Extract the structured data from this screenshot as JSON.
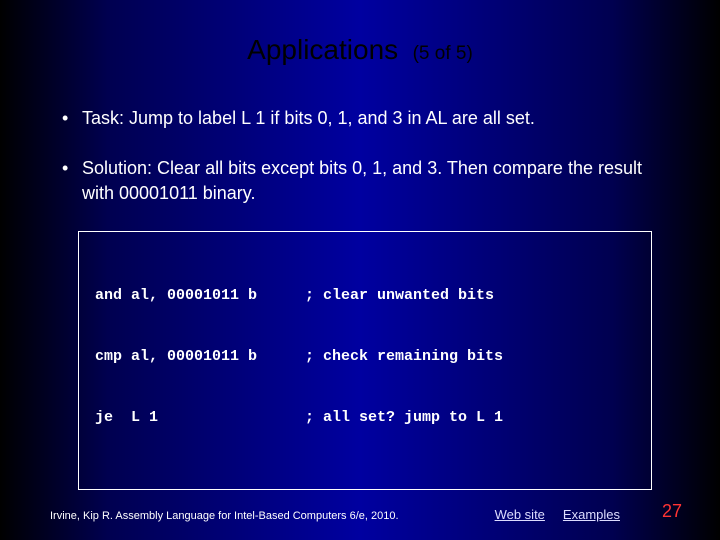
{
  "title": {
    "main": "Applications",
    "sub": "(5 of 5)"
  },
  "bullets": [
    "Task: Jump to label L 1 if bits 0, 1, and 3 in AL are all set.",
    "Solution: Clear all bits except bits 0, 1, and 3. Then compare the result with 00001011 binary."
  ],
  "code": {
    "lines": [
      {
        "left": "and al, 00001011 b",
        "right": "; clear unwanted bits"
      },
      {
        "left": "cmp al, 00001011 b",
        "right": "; check remaining bits"
      },
      {
        "left": "je  L 1",
        "right": "; all set? jump to L 1"
      }
    ]
  },
  "footer": {
    "citation": "Irvine, Kip R. Assembly Language for Intel-Based Computers 6/e, 2010.",
    "links": {
      "website": "Web site",
      "examples": "Examples"
    }
  },
  "page_number": "27"
}
